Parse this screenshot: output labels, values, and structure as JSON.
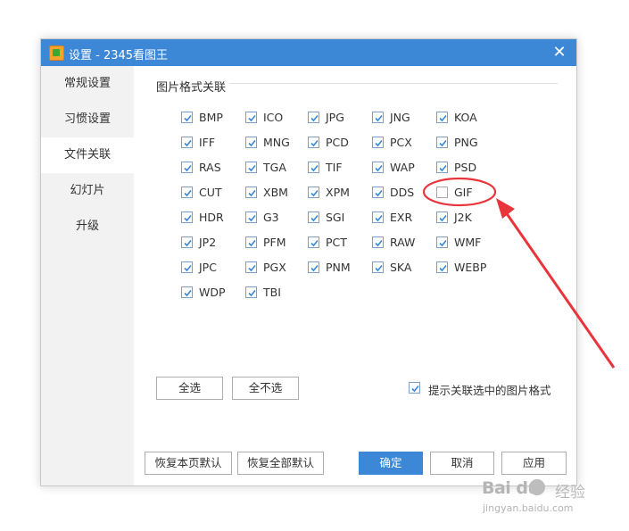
{
  "window": {
    "title": "设置 - 2345看图王",
    "close_glyph": "✕"
  },
  "sidebar": {
    "items": [
      {
        "label": "常规设置"
      },
      {
        "label": "习惯设置"
      },
      {
        "label": "文件关联"
      },
      {
        "label": "幻灯片"
      },
      {
        "label": "升级"
      }
    ],
    "active": "文件关联"
  },
  "section": {
    "title": "图片格式关联"
  },
  "formats": [
    {
      "label": "BMP",
      "checked": true
    },
    {
      "label": "ICO",
      "checked": true
    },
    {
      "label": "JPG",
      "checked": true
    },
    {
      "label": "JNG",
      "checked": true
    },
    {
      "label": "KOA",
      "checked": true
    },
    {
      "label": "IFF",
      "checked": true
    },
    {
      "label": "MNG",
      "checked": true
    },
    {
      "label": "PCD",
      "checked": true
    },
    {
      "label": "PCX",
      "checked": true
    },
    {
      "label": "PNG",
      "checked": true
    },
    {
      "label": "RAS",
      "checked": true
    },
    {
      "label": "TGA",
      "checked": true
    },
    {
      "label": "TIF",
      "checked": true
    },
    {
      "label": "WAP",
      "checked": true
    },
    {
      "label": "PSD",
      "checked": true
    },
    {
      "label": "CUT",
      "checked": true
    },
    {
      "label": "XBM",
      "checked": true
    },
    {
      "label": "XPM",
      "checked": true
    },
    {
      "label": "DDS",
      "checked": true
    },
    {
      "label": "GIF",
      "checked": false
    },
    {
      "label": "HDR",
      "checked": true
    },
    {
      "label": "G3",
      "checked": true
    },
    {
      "label": "SGI",
      "checked": true
    },
    {
      "label": "EXR",
      "checked": true
    },
    {
      "label": "J2K",
      "checked": true
    },
    {
      "label": "JP2",
      "checked": true
    },
    {
      "label": "PFM",
      "checked": true
    },
    {
      "label": "PCT",
      "checked": true
    },
    {
      "label": "RAW",
      "checked": true
    },
    {
      "label": "WMF",
      "checked": true
    },
    {
      "label": "JPC",
      "checked": true
    },
    {
      "label": "PGX",
      "checked": true
    },
    {
      "label": "PNM",
      "checked": true
    },
    {
      "label": "SKA",
      "checked": true
    },
    {
      "label": "WEBP",
      "checked": true
    },
    {
      "label": "WDP",
      "checked": true
    },
    {
      "label": "TBI",
      "checked": true
    }
  ],
  "buttons": {
    "select_all": "全选",
    "select_none": "全不选",
    "restore_page": "恢复本页默认",
    "restore_all": "恢复全部默认",
    "ok": "确定",
    "cancel": "取消",
    "apply": "应用"
  },
  "hint": {
    "label": "提示关联选中的图片格式",
    "checked": true
  },
  "colors": {
    "accent": "#3c87d6",
    "annotation": "#e8343a",
    "checkbox_border": "#7c9ec9"
  },
  "watermark": {
    "logo_text": "Bai du",
    "cn_text": "经验",
    "url_text": "jingyan.baidu.com"
  }
}
